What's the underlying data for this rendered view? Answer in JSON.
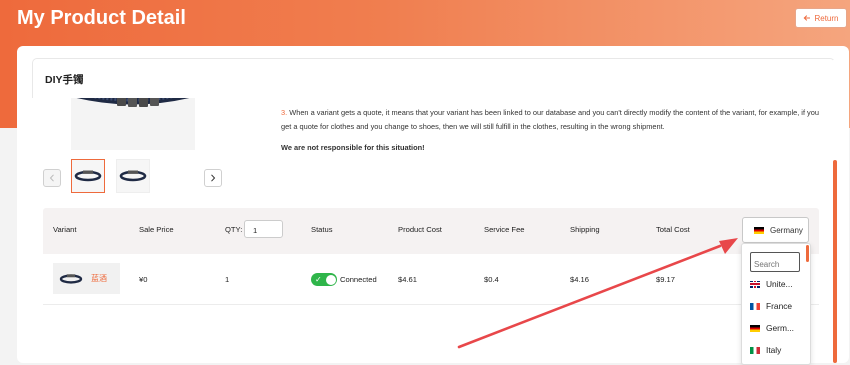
{
  "page": {
    "title": "My Product Detail",
    "return_label": "Return"
  },
  "product": {
    "name": "DIY手镯",
    "notes": {
      "item3_number": "3.",
      "item3_text": "When a variant gets a quote, it means that your variant has been linked to our database and you can't directly modify the content of the variant, for example, if you get a quote for clothes and you change to shoes, then we will still fulfill in the clothes, resulting in the wrong shipment.",
      "disclaimer": "We are not responsible for this situation!"
    }
  },
  "gallery": {
    "thumbnails": [
      "bracelet-image",
      "bracelet-image"
    ],
    "selected_index": 0
  },
  "table": {
    "headers": {
      "variant": "Variant",
      "sale_price": "Sale Price",
      "qty_label": "QTY:",
      "status": "Status",
      "product_cost": "Product Cost",
      "service_fee": "Service Fee",
      "shipping": "Shipping",
      "total_cost": "Total Cost"
    },
    "qty_value": "1",
    "country": "Germany",
    "rows": [
      {
        "variant_name": "蓝酒",
        "sale_price": "¥0",
        "qty": "1",
        "status_on": true,
        "status_label": "Connected",
        "product_cost": "$4.61",
        "service_fee": "$0.4",
        "shipping": "$4.16",
        "total_cost": "$9.17"
      }
    ]
  },
  "country_dropdown": {
    "search_placeholder": "Search",
    "options": [
      "Unite...",
      "France",
      "Germ...",
      "Italy"
    ],
    "flags": [
      "uk-flag-icon",
      "france-flag-icon",
      "germany-flag-icon",
      "italy-flag-icon"
    ]
  },
  "colors": {
    "accent": "#ee6a3c",
    "toggle_on": "#2fb54a",
    "annotation_arrow": "#e8474a"
  }
}
